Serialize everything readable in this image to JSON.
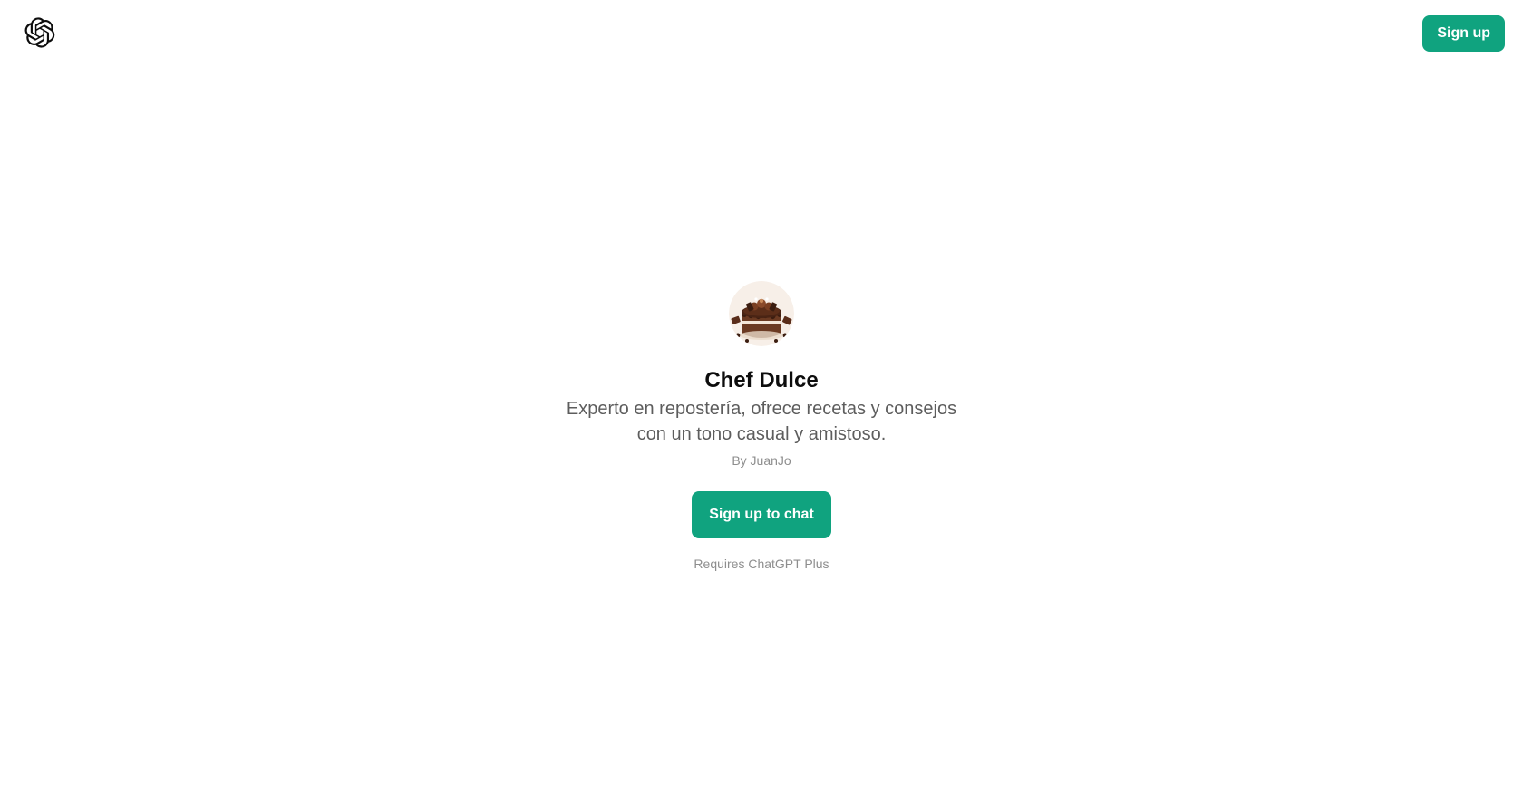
{
  "header": {
    "logo_icon": "openai-logo-icon",
    "signup_label": "Sign up"
  },
  "gpt": {
    "avatar_icon": "chocolate-cake-avatar",
    "title": "Chef Dulce",
    "description": "Experto en repostería, ofrece recetas y consejos con un tono casual y amistoso.",
    "author": "By JuanJo"
  },
  "actions": {
    "chat_button_label": "Sign up to chat",
    "requirement": "Requires ChatGPT Plus"
  },
  "colors": {
    "accent": "#10a37f",
    "background": "#ffffff",
    "text_primary": "#0d0d0d",
    "text_secondary": "#5d5d5d",
    "text_muted": "#8e8e8e"
  }
}
